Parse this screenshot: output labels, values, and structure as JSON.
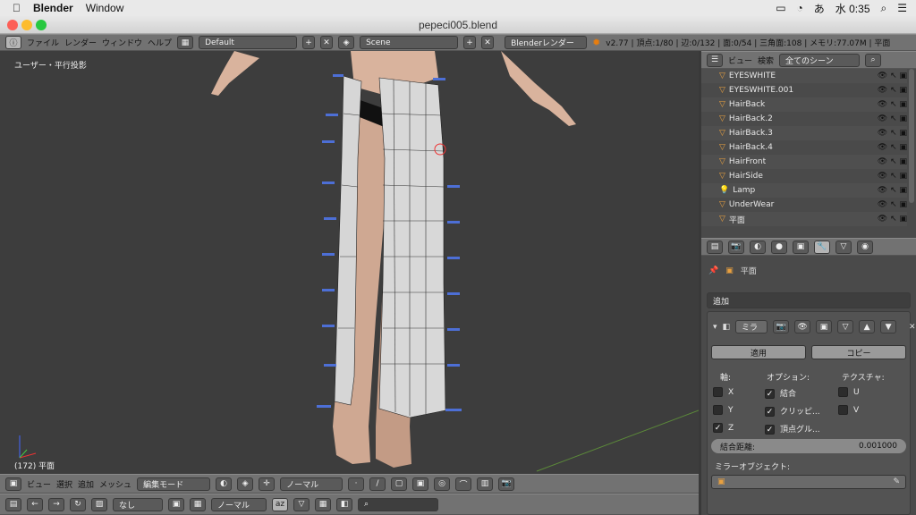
{
  "macbar": {
    "app": "Blender",
    "menu_window": "Window",
    "clock": "水 0:35"
  },
  "window": {
    "title": "pepeci005.blend"
  },
  "info_header": {
    "menus": [
      "ファイル",
      "レンダー",
      "ウィンドウ",
      "ヘルプ"
    ],
    "layout": "Default",
    "scene": "Scene",
    "engine": "Blenderレンダー",
    "stats": "v2.77 | 頂点:1/80 | 辺:0/132 | 面:0/54 | 三角面:108 | メモリ:77.07M | 平面"
  },
  "viewport": {
    "view_label": "ユーザー・平行投影",
    "selection_label": "(172) 平面"
  },
  "outliner": {
    "menus": [
      "ビュー",
      "検索"
    ],
    "filter": "全てのシーン",
    "items": [
      {
        "name": "EYESWHITE"
      },
      {
        "name": "EYESWHITE.001"
      },
      {
        "name": "HairBack"
      },
      {
        "name": "HairBack.2"
      },
      {
        "name": "HairBack.3"
      },
      {
        "name": "HairBack.4"
      },
      {
        "name": "HairFront"
      },
      {
        "name": "HairSide"
      },
      {
        "name": "Lamp"
      },
      {
        "name": "UnderWear"
      },
      {
        "name": "平面"
      }
    ]
  },
  "properties": {
    "breadcrumb": "平面",
    "add_modifier": "追加",
    "modifier_name": "ミラ",
    "apply": "適用",
    "copy": "コピー",
    "axis_label": "軸:",
    "options_label": "オプション:",
    "texture_label": "テクスチャ:",
    "axes": [
      {
        "label": "X",
        "checked": false
      },
      {
        "label": "Y",
        "checked": false
      },
      {
        "label": "Z",
        "checked": true
      }
    ],
    "options": [
      {
        "label": "結合",
        "checked": true
      },
      {
        "label": "クリッピ...",
        "checked": true
      },
      {
        "label": "頂点グル...",
        "checked": true
      }
    ],
    "textures": [
      {
        "label": "U",
        "checked": false
      },
      {
        "label": "V",
        "checked": false
      }
    ],
    "merge_label": "結合距離:",
    "merge_value": "0.001000",
    "mirror_object_label": "ミラーオブジェクト:"
  },
  "view3d_header": {
    "menus": [
      "ビュー",
      "選択",
      "追加",
      "メッシュ"
    ],
    "mode": "編集モード",
    "orientation": "ノーマル"
  },
  "uv_header": {
    "pivot": "なし",
    "orientation": "ノーマル"
  }
}
